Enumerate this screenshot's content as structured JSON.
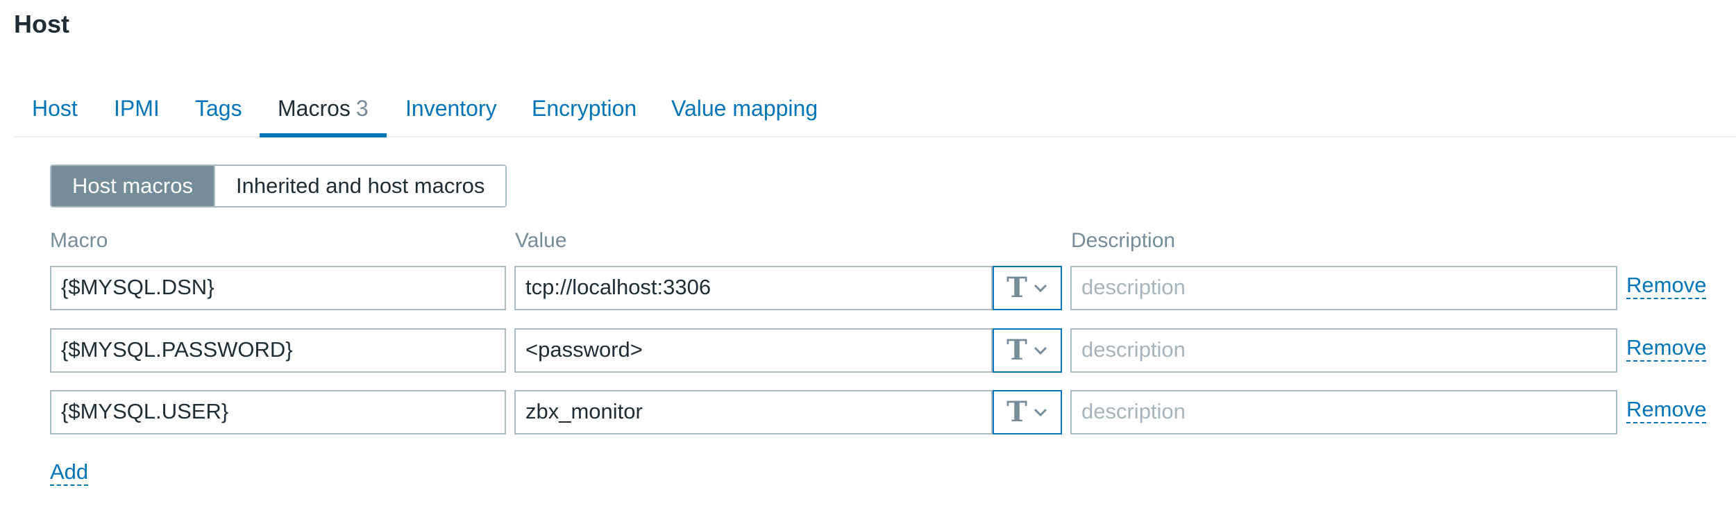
{
  "page": {
    "title": "Host"
  },
  "tabs": [
    {
      "label": "Host"
    },
    {
      "label": "IPMI"
    },
    {
      "label": "Tags"
    },
    {
      "label": "Macros",
      "count": "3",
      "active": true
    },
    {
      "label": "Inventory"
    },
    {
      "label": "Encryption"
    },
    {
      "label": "Value mapping"
    }
  ],
  "macro_view": {
    "host_macros_label": "Host macros",
    "inherited_label": "Inherited and host macros",
    "selected": "Host macros"
  },
  "columns": {
    "macro": "Macro",
    "value": "Value",
    "description": "Description"
  },
  "macros": [
    {
      "macro": "{$MYSQL.DSN}",
      "value": "tcp://localhost:3306",
      "description_placeholder": "description",
      "type_icon": "text-type-icon",
      "remove_label": "Remove"
    },
    {
      "macro": "{$MYSQL.PASSWORD}",
      "value": "<password>",
      "description_placeholder": "description",
      "type_icon": "text-type-icon",
      "remove_label": "Remove"
    },
    {
      "macro": "{$MYSQL.USER}",
      "value": "zbx_monitor",
      "description_placeholder": "description",
      "type_icon": "text-type-icon",
      "remove_label": "Remove"
    }
  ],
  "actions": {
    "add_label": "Add"
  },
  "colors": {
    "link": "#0275b8",
    "muted": "#768d99",
    "border": "#acbbc2",
    "text": "#1f2c33"
  }
}
